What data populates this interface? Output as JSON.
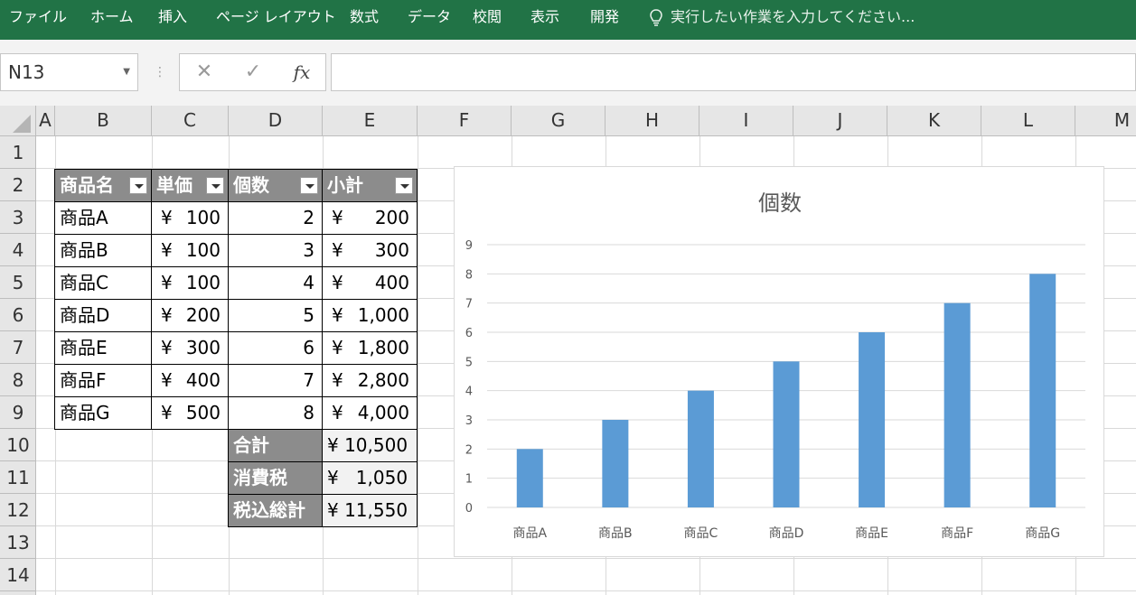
{
  "ribbon": {
    "tabs": [
      "ファイル",
      "ホーム",
      "挿入",
      "ページ レイアウト",
      "数式",
      "データ",
      "校閲",
      "表示",
      "開発"
    ],
    "tell_me": "実行したい作業を入力してください..."
  },
  "formula_bar": {
    "name_box": "N13",
    "separator": "⋮",
    "cancel_icon": "✕",
    "enter_icon": "✓",
    "fx_label": "fx",
    "formula": ""
  },
  "columns": [
    "A",
    "B",
    "C",
    "D",
    "E",
    "F",
    "G",
    "H",
    "I",
    "J",
    "K",
    "L",
    "M"
  ],
  "rows": [
    "1",
    "2",
    "3",
    "4",
    "5",
    "6",
    "7",
    "8",
    "9",
    "10",
    "11",
    "12",
    "13",
    "14"
  ],
  "table": {
    "headers": [
      "商品名",
      "単価",
      "個数",
      "小計"
    ],
    "currency": "¥",
    "rows": [
      {
        "name": "商品A",
        "price": "100",
        "qty": "2",
        "subtotal": "200"
      },
      {
        "name": "商品B",
        "price": "100",
        "qty": "3",
        "subtotal": "300"
      },
      {
        "name": "商品C",
        "price": "100",
        "qty": "4",
        "subtotal": "400"
      },
      {
        "name": "商品D",
        "price": "200",
        "qty": "5",
        "subtotal": "1,000"
      },
      {
        "name": "商品E",
        "price": "300",
        "qty": "6",
        "subtotal": "1,800"
      },
      {
        "name": "商品F",
        "price": "400",
        "qty": "7",
        "subtotal": "2,800"
      },
      {
        "name": "商品G",
        "price": "500",
        "qty": "8",
        "subtotal": "4,000"
      }
    ],
    "totals": [
      {
        "label": "合計",
        "value": "¥ 10,500"
      },
      {
        "label": "消費税",
        "value": "¥   1,050"
      },
      {
        "label": "税込総計",
        "value": "¥ 11,550"
      }
    ]
  },
  "colors": {
    "ribbon": "#217346",
    "table_header": "#8c8c8c",
    "bar": "#5b9bd5"
  },
  "chart_data": {
    "type": "bar",
    "title": "個数",
    "categories": [
      "商品A",
      "商品B",
      "商品C",
      "商品D",
      "商品E",
      "商品F",
      "商品G"
    ],
    "values": [
      2,
      3,
      4,
      5,
      6,
      7,
      8
    ],
    "ylim": [
      0,
      9
    ],
    "yticks": [
      "0",
      "1",
      "2",
      "3",
      "4",
      "5",
      "6",
      "7",
      "8",
      "9"
    ],
    "grid": true,
    "color": "#5b9bd5"
  }
}
